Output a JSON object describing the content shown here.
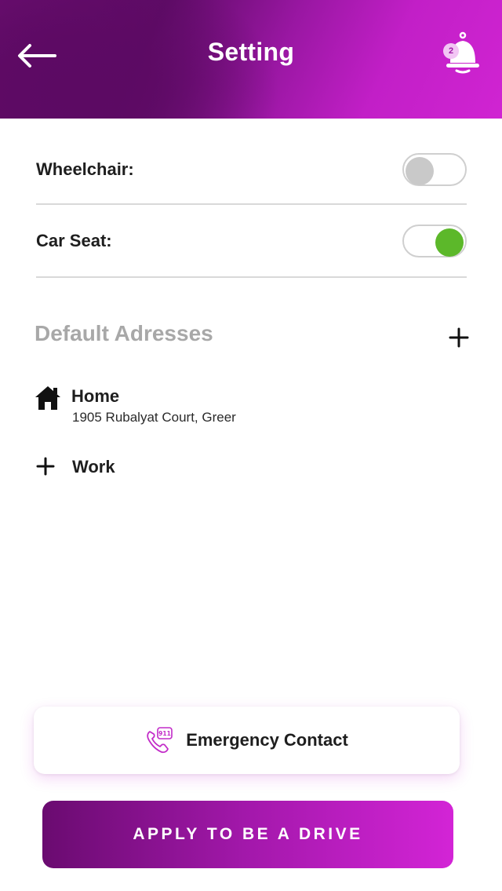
{
  "header": {
    "title": "Setting",
    "notification_count": "2",
    "back_icon": "arrow-left-icon",
    "bell_icon": "bell-icon"
  },
  "preferences": [
    {
      "label": "Wheelchair:",
      "enabled": false
    },
    {
      "label": "Car Seat:",
      "enabled": true
    }
  ],
  "addresses": {
    "section_title": "Default Adresses",
    "add_icon": "plus-icon",
    "items": [
      {
        "title": "Home",
        "address": "1905 Rubalyat Court, Greer",
        "icon": "home-icon"
      },
      {
        "title": "Work",
        "address": "",
        "icon": "plus-icon"
      }
    ]
  },
  "emergency": {
    "label": "Emergency Contact",
    "icon": "phone-911-icon"
  },
  "apply": {
    "label": "APPLY TO BE A DRIVE"
  },
  "colors": {
    "brand_dark": "#5e0b66",
    "brand_light": "#d024d2",
    "toggle_on": "#5cb82a",
    "toggle_off": "#c9c9c9"
  }
}
